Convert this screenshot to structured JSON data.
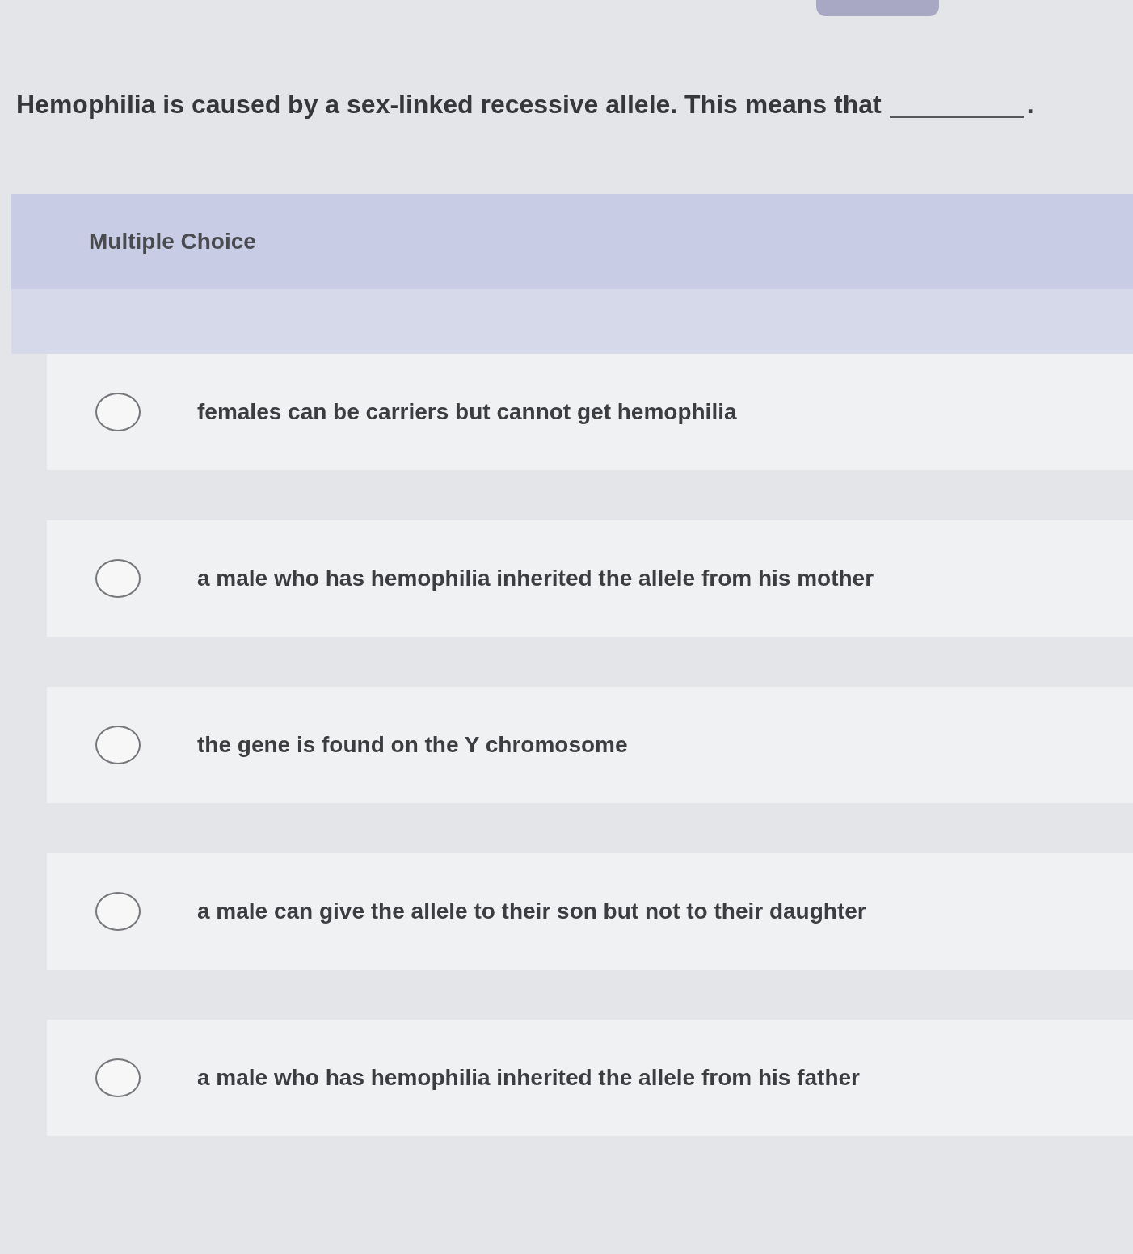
{
  "question": {
    "text": "Hemophilia is caused by a sex-linked recessive allele. This means that",
    "after_blank": "."
  },
  "section": {
    "title": "Multiple Choice"
  },
  "options": [
    {
      "label": "females can be carriers but cannot get hemophilia",
      "selected": false
    },
    {
      "label": "a male who has hemophilia inherited the allele from his mother",
      "selected": false
    },
    {
      "label": "the gene is found on the Y chromosome",
      "selected": false
    },
    {
      "label": "a male can give the allele to their son but not to their daughter",
      "selected": false
    },
    {
      "label": "a male who has hemophilia inherited the allele from his father",
      "selected": false
    }
  ]
}
